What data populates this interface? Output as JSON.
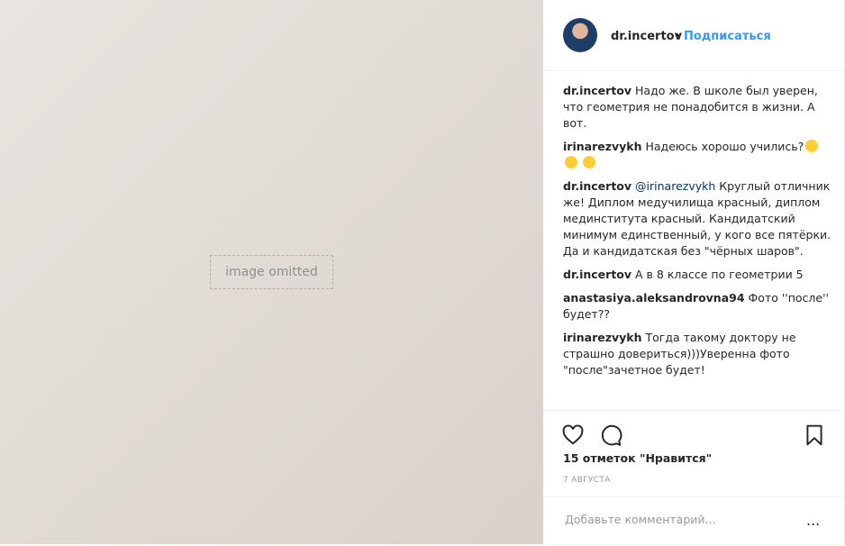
{
  "photo": {
    "placeholder": "image omitted"
  },
  "header": {
    "username": "dr.incertov",
    "separator": "•",
    "follow_label": "Подписаться"
  },
  "comments": [
    {
      "user": "dr.incertov",
      "text": "Надо же. В школе был уверен, что геометрия не понадобится в жизни. А вот."
    },
    {
      "user": "irinarezvykh",
      "text": "Надеюсь хорошо учились?"
    },
    {
      "user": "dr.incertov",
      "mention": "@irinarezvykh",
      "text": "Круглый отличник же! Диплом медучилища красный, диплом мединститута красный. Кандидатский минимум единственный, у кого все пятёрки. Да и кандидатская без \"чёрных шаров\"."
    },
    {
      "user": "dr.incertov",
      "text": "А в 8 классе по геометрии 5"
    },
    {
      "user": "anastasiya.aleksandrovna94",
      "text": "Фото ''после'' будет??"
    },
    {
      "user": "irinarezvykh",
      "text": "Тогда такому доктору не страшно довериться)))Уверенна фото \"после\"зачетное будет!"
    }
  ],
  "actions": {
    "icons": [
      "heart-icon",
      "comment-icon",
      "bookmark-icon"
    ],
    "likes": "15 отметок \"Нравится\"",
    "date": "7 АВГУСТА"
  },
  "add_comment": {
    "placeholder": "Добавьте комментарий...",
    "more": "..."
  }
}
